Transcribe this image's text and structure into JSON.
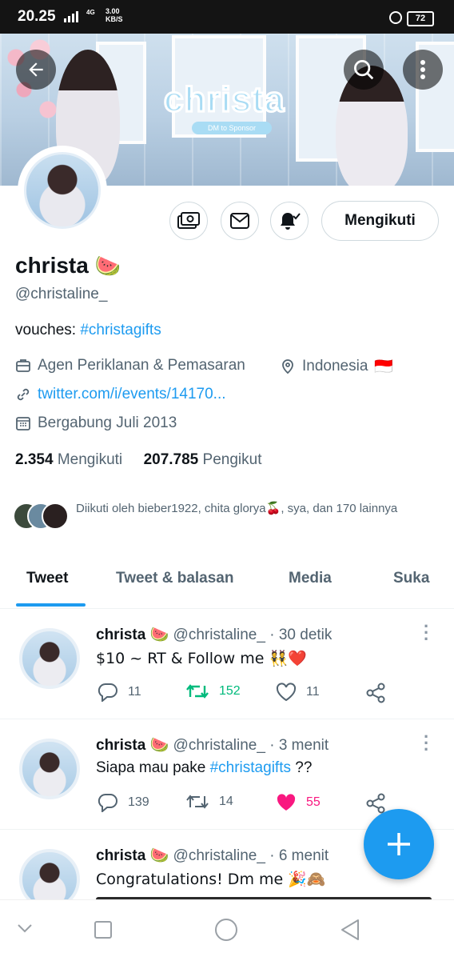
{
  "status_bar": {
    "time": "20.25",
    "network": "4G",
    "speed_value": "3.00",
    "speed_unit": "KB/S",
    "battery": "72"
  },
  "banner": {
    "title": "christa",
    "subtitle": "DM to Sponsor"
  },
  "profile": {
    "name": "christa",
    "name_emoji": "🍉",
    "handle": "@christaline_",
    "bio_prefix": "vouches: ",
    "bio_hashtag": "#christagifts",
    "category": "Agen Periklanan & Pemasaran",
    "location": "Indonesia",
    "location_flag": "🇮🇩",
    "website": "twitter.com/i/events/14170...",
    "joined": "Bergabung Juli 2013",
    "following_count": "2.354",
    "following_label": "Mengikuti",
    "followers_count": "207.785",
    "followers_label": "Pengikut",
    "followed_by": "Diikuti oleh bieber1922, chita glorya🍒, sya, dan 170 lainnya",
    "follow_button": "Mengikuti"
  },
  "tabs": [
    "Tweet",
    "Tweet & balasan",
    "Media",
    "Suka"
  ],
  "tweets": [
    {
      "name": "christa",
      "emoji": "🍉",
      "handle": "@christaline_",
      "time": "· 30 detik",
      "text": "$10 ~ RT & Follow me 👯❤️",
      "text_hashtag": "",
      "text_suffix": "",
      "replies": "11",
      "retweets": "152",
      "likes": "11",
      "retweeted": true,
      "liked": false
    },
    {
      "name": "christa",
      "emoji": "🍉",
      "handle": "@christaline_",
      "time": "· 3 menit",
      "text": "Siapa mau pake ",
      "text_hashtag": "#christagifts",
      "text_suffix": " ??",
      "replies": "139",
      "retweets": "14",
      "likes": "55",
      "retweeted": false,
      "liked": true
    },
    {
      "name": "christa",
      "emoji": "🍉",
      "handle": "@christaline_",
      "time": "· 6 menit",
      "text": "Congratulations! Dm me 🎉🙈",
      "text_hashtag": "",
      "text_suffix": ""
    }
  ],
  "colors": {
    "accent": "#1d9bf0",
    "retweet": "#00ba7c",
    "like": "#f91880",
    "text": "#0f1419",
    "secondary": "#536471"
  },
  "fab_icon": "plus-icon"
}
